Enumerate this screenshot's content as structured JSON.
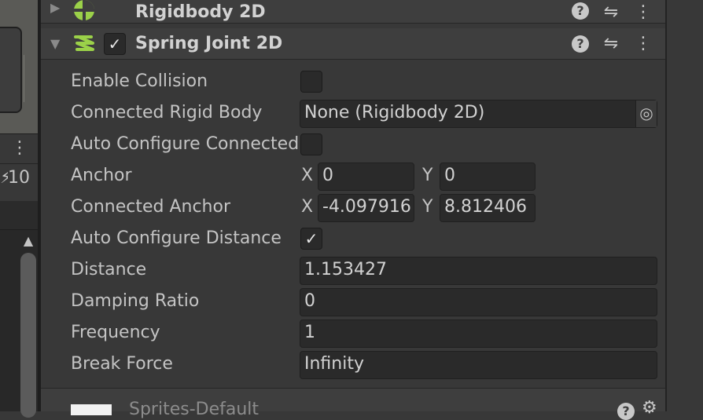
{
  "left_panel": {
    "more_icon": "⋮",
    "count_label": "10",
    "scroll_up_icon": "▲"
  },
  "rigidbody": {
    "title": "Rigidbody 2D",
    "foldout_icon": "▶",
    "help_icon": "?",
    "presets_icon": "⇋",
    "more_icon": "⋮"
  },
  "spring_joint": {
    "title": "Spring Joint 2D",
    "foldout_icon": "▼",
    "enabled_check": "✓",
    "help_icon": "?",
    "presets_icon": "⇋",
    "more_icon": "⋮",
    "fields": {
      "enable_collision": {
        "label": "Enable Collision",
        "checked": false
      },
      "connected_rigid_body": {
        "label": "Connected Rigid Body",
        "value": "None (Rigidbody 2D)",
        "picker_icon": "◎"
      },
      "auto_configure_connected": {
        "label": "Auto Configure Connected Anchor",
        "checked": false
      },
      "anchor": {
        "label": "Anchor",
        "x_label": "X",
        "x": "0",
        "y_label": "Y",
        "y": "0"
      },
      "connected_anchor": {
        "label": "Connected Anchor",
        "x_label": "X",
        "x": "-4.097916",
        "y_label": "Y",
        "y": "8.812406"
      },
      "auto_configure_distance": {
        "label": "Auto Configure Distance",
        "checked": true,
        "check": "✓"
      },
      "distance": {
        "label": "Distance",
        "value": "1.153427"
      },
      "damping_ratio": {
        "label": "Damping Ratio",
        "value": "0"
      },
      "frequency": {
        "label": "Frequency",
        "value": "1"
      },
      "break_force": {
        "label": "Break Force",
        "value": "Infinity"
      }
    }
  },
  "material": {
    "title": "Sprites-Default",
    "help_icon": "?",
    "gear_icon": "⚙"
  },
  "colors": {
    "rigidbody_icon": "#9bd149",
    "spring_icon": "#9bd149"
  }
}
